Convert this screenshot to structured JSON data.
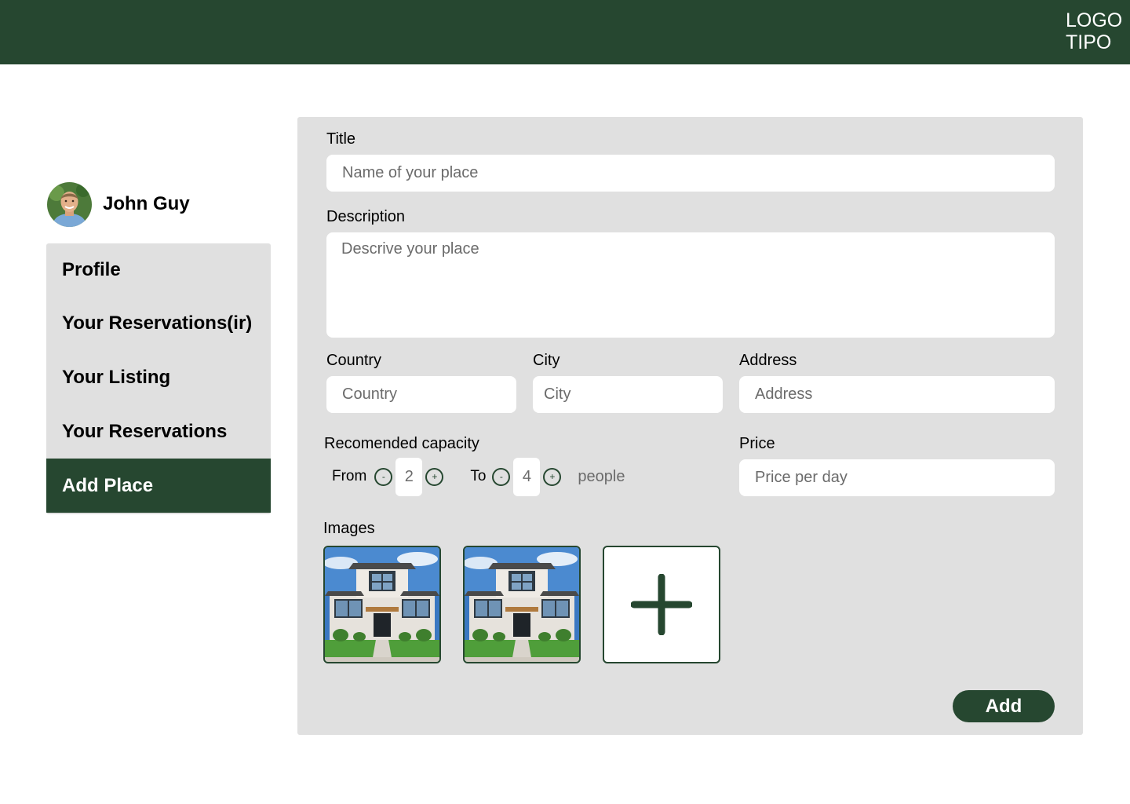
{
  "header": {
    "logo_line1": "LOGO",
    "logo_line2": "TIPO",
    "background_color": "#264730"
  },
  "user": {
    "name": "John Guy",
    "avatar_icon": "person-avatar"
  },
  "sidebar": {
    "items": [
      {
        "label": "Profile",
        "active": false
      },
      {
        "label": "Your Reservations(ir)",
        "active": false
      },
      {
        "label": "Your Listing",
        "active": false
      },
      {
        "label": "Your Reservations",
        "active": false
      },
      {
        "label": "Add Place",
        "active": true
      }
    ]
  },
  "form": {
    "title": {
      "label": "Title",
      "placeholder": "Name of your place"
    },
    "description": {
      "label": "Description",
      "placeholder": "Descrive your place"
    },
    "country": {
      "label": "Country",
      "placeholder": "Country"
    },
    "city": {
      "label": "City",
      "placeholder": "City"
    },
    "address": {
      "label": "Address",
      "placeholder": "Address"
    },
    "capacity": {
      "label": "Recomended capacity",
      "from_label": "From",
      "from_value": "2",
      "to_label": "To",
      "to_value": "4",
      "unit": "people",
      "minus_symbol": "-",
      "plus_symbol": "+"
    },
    "price": {
      "label": "Price",
      "placeholder": "Price per day"
    },
    "images": {
      "label": "Images",
      "items": [
        {
          "icon": "house-photo"
        },
        {
          "icon": "house-photo"
        }
      ],
      "add_icon": "plus-icon"
    },
    "submit_label": "Add"
  },
  "colors": {
    "accent": "#264730",
    "panel": "#e0e0e0",
    "placeholder": "#6b6b6b"
  }
}
